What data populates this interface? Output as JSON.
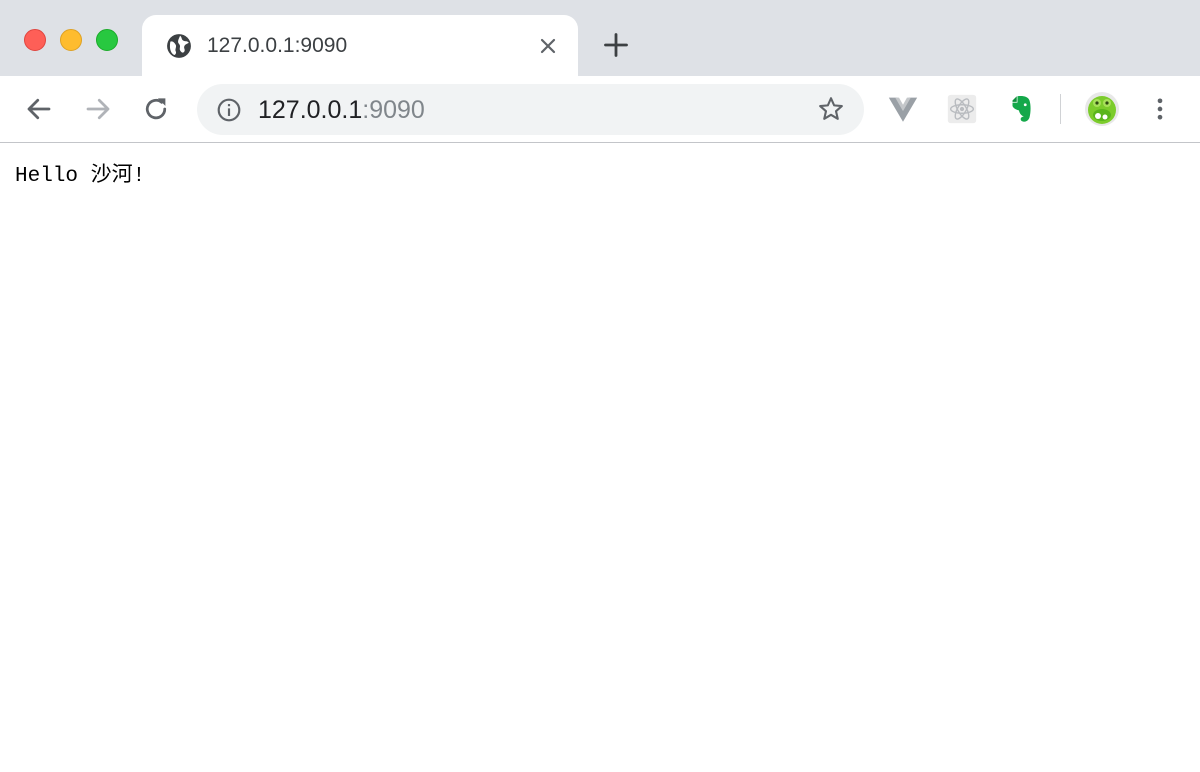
{
  "window": {
    "controls": [
      "close",
      "minimize",
      "zoom"
    ]
  },
  "tabs": [
    {
      "title": "127.0.0.1:9090",
      "icon": "globe-icon",
      "active": true
    }
  ],
  "toolbar": {
    "url_host": "127.0.0.1",
    "url_port": ":9090",
    "info_icon": "info-icon",
    "bookmark_icon": "star-icon",
    "extensions": [
      "vue-devtools-icon",
      "react-devtools-icon",
      "evernote-icon",
      "profile-avatar"
    ]
  },
  "page": {
    "body_text": "Hello 沙河!"
  },
  "colors": {
    "tabstrip": "#dee1e6",
    "omnibox": "#f1f3f4",
    "close": "#fe5f57",
    "minimize": "#febc2e",
    "zoom": "#28c840",
    "evernote": "#14a84a"
  }
}
